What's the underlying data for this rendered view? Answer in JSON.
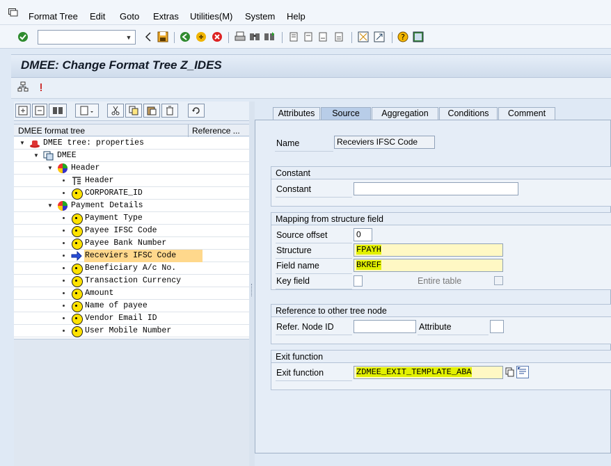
{
  "menu": {
    "items": [
      "Format Tree",
      "Edit",
      "Goto",
      "Extras",
      "Utilities(M)",
      "System",
      "Help"
    ]
  },
  "title": "DMEE: Change Format Tree Z_IDES",
  "tree": {
    "columns": [
      "DMEE format tree",
      "Reference ..."
    ],
    "nodes": [
      {
        "label": "DMEE tree: properties"
      },
      {
        "label": "DMEE"
      },
      {
        "label": "Header"
      },
      {
        "label": "Header"
      },
      {
        "label": "CORPORATE_ID"
      },
      {
        "label": "Payment Details"
      },
      {
        "label": "Payment Type"
      },
      {
        "label": "Payee IFSC Code"
      },
      {
        "label": "Payee Bank Number"
      },
      {
        "label": "Receviers IFSC Code"
      },
      {
        "label": "Beneficiary A/c No."
      },
      {
        "label": "Transaction Currency"
      },
      {
        "label": "Amount"
      },
      {
        "label": "Name of payee"
      },
      {
        "label": "Vendor Email ID"
      },
      {
        "label": "User Mobile Number"
      }
    ]
  },
  "tabs": [
    "Attributes",
    "Source",
    "Aggregation",
    "Conditions",
    "Comment"
  ],
  "form": {
    "name_label": "Name",
    "name_value": "Receviers IFSC Code",
    "constant": {
      "title": "Constant",
      "label": "Constant",
      "value": ""
    },
    "mapping": {
      "title": "Mapping from structure field",
      "source_offset_label": "Source offset",
      "source_offset_value": "0",
      "structure_label": "Structure",
      "structure_value": "FPAYH",
      "field_name_label": "Field name",
      "field_name_value": "BKREF",
      "key_field_label": "Key field",
      "entire_table_label": "Entire table"
    },
    "reference": {
      "title": "Reference to other tree node",
      "node_id_label": "Refer. Node ID",
      "node_id_value": "",
      "attribute_label": "Attribute",
      "attribute_value": ""
    },
    "exit": {
      "title": "Exit function",
      "label": "Exit function",
      "value": "ZDMEE_EXIT_TEMPLATE_ABA"
    }
  },
  "colors": {
    "highlight": "#e2f000",
    "selected_row": "#ffd88c",
    "node_yellow": "#ffe200",
    "active_tab": "#b8cde8"
  }
}
